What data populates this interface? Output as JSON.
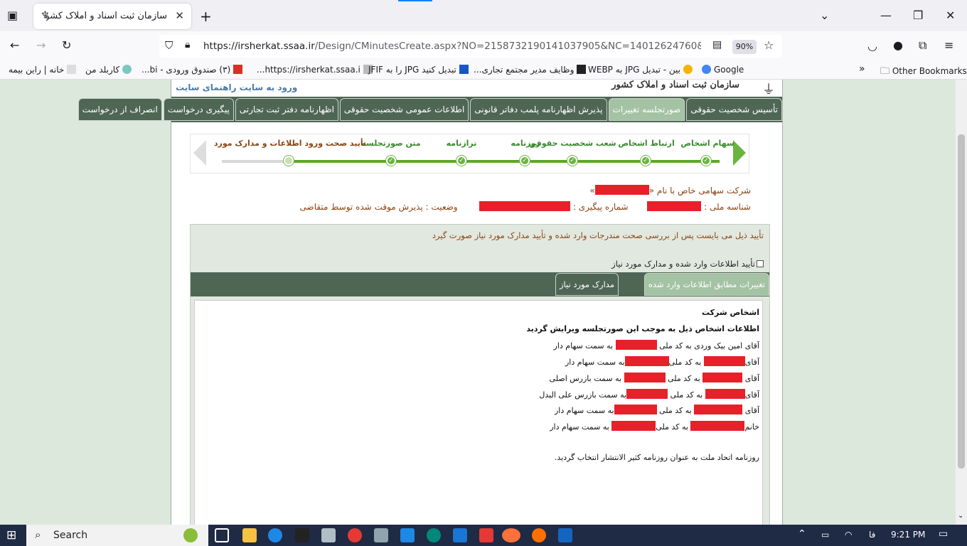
{
  "browser": {
    "tab_title": "سازمان ثبت اسناد و املاک کشور",
    "url_host": "https://irsherkat.ssaa.ir",
    "url_path": "/Design/CMinutesCreate.aspx?NO=2158732190141037905&NC=14012624760&CSRF=0a",
    "zoom": "90%",
    "bookmarks": [
      {
        "label": "خانه | راین بیمه"
      },
      {
        "label": "کاربلد من"
      },
      {
        "label": "(۳) صندوق ورودی - bi..."
      },
      {
        "label": "https://irsherkat.ssaa.i..."
      },
      {
        "label": "تبدیل کنید JPG را به JFIF"
      },
      {
        "label": "وظایف مدیر مجتمع تجاری..."
      },
      {
        "label": "بین - تبدیل JPG به WEBP"
      },
      {
        "label": "Google"
      }
    ],
    "other_bookmarks": "Other Bookmarks"
  },
  "header": {
    "links": "ورود به سایت   راهنمای سایت",
    "logo": "سازمان ثبت اسناد و املاک کشور"
  },
  "topnav": [
    {
      "label": "تأسیس شخصیت حقوقی",
      "active": false
    },
    {
      "label": "صورتجلسه تغییرات",
      "active": true
    },
    {
      "label": "پذیرش اظهارنامه پلمب دفاتر قانونی",
      "active": false
    },
    {
      "label": "اطلاعات عمومی شخصیت حقوقی",
      "active": false
    },
    {
      "label": "اظهارنامه دفتر ثبت تجارتی",
      "active": false
    },
    {
      "label": "پیگیری درخواست",
      "active": false
    },
    {
      "label": "انصراف از درخواست",
      "active": false
    }
  ],
  "wizard": {
    "steps": [
      {
        "label": "سهام اشخاص",
        "done": true
      },
      {
        "label": "ارتباط اشخاص",
        "done": true
      },
      {
        "label": "شعب شخصیت حقوقی",
        "done": true
      },
      {
        "label": "روزنامه",
        "done": true
      },
      {
        "label": "ترازنامه",
        "done": true
      },
      {
        "label": "متن صورتجلسه",
        "done": true
      },
      {
        "label": "تأیید صحت ورود اطلاعات و مدارک مورد",
        "done": false
      }
    ]
  },
  "company": {
    "name_prefix": "شرکت سهامی خاص با نام «",
    "name_suffix": "»",
    "national_id_label": "شناسه ملی :",
    "tracking_label": "شماره پیگیری :",
    "status_label": "وضعیت : پذیرش موقت شده توسط متقاضی"
  },
  "panel": {
    "message": "تأیید ذیل می بایست پس از بررسی صحت مندرجات وارد شده و تأیید مدارک مورد نیاز صورت گیرد",
    "checkbox_label": "تأیید اطلاعات وارد شده و مدارک مورد نیاز",
    "tabs": [
      "تغییرات مطابق اطلاعات وارد شده",
      "مدارک مورد نیاز"
    ]
  },
  "content": {
    "heading": "اشخاص شرکت",
    "subheading": "اطلاعات اشخاص ذیل به موجب این صورتجلسه ویرایش گردید",
    "line1": "آقای امین بیک وردی به کد ملی",
    "line1_role": "به سمت سهام دار",
    "persons": [
      {
        "title": "آقای",
        "national_code_label": "به کد ملی",
        "role": "به سمت سهام دار"
      },
      {
        "title": "آقای",
        "national_code_label": "به کد ملی",
        "role": "به سمت بازرس اصلی"
      },
      {
        "title": "آقای",
        "national_code_label": "به کد ملی",
        "role": "به سمت بازرس علی البدل"
      },
      {
        "title": "آقای",
        "national_code_label": "به کد ملی",
        "role": "به سمت سهام دار"
      },
      {
        "title": "خانم",
        "national_code_label": "به کد ملی",
        "role": "به سمت سهام دار"
      }
    ],
    "newspaper": "روزنامه اتحاد ملت به عنوان روزنامه کثیر الانتشار انتخاب گردید."
  },
  "taskbar": {
    "search": "Search",
    "lang": "فا",
    "time": "9:21 PM"
  },
  "colors": {
    "accent_green": "#4f6655",
    "active_tab": "#a4c2a4",
    "redaction": "#e8202a",
    "status_brown": "#8b4513"
  }
}
